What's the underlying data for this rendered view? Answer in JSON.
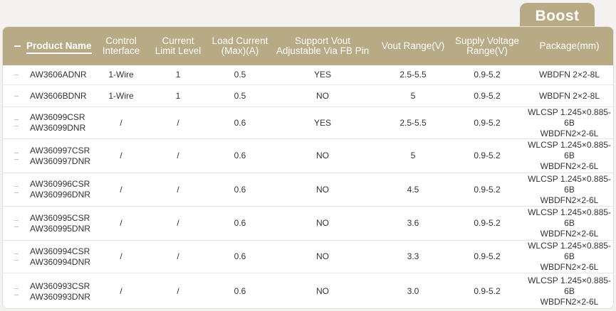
{
  "tab": {
    "label": "Boost"
  },
  "columns": [
    "Product Name",
    "Control\nInterface",
    "Current\nLimit Level",
    "Load Current\n(Max)(A)",
    "Support Vout\nAdjustable Via FB Pin",
    "Vout Range(V)",
    "Supply Voltage\nRange(V)",
    "Package(mm)"
  ],
  "rows": [
    {
      "name": "AW3606ADNR",
      "control": "1-Wire",
      "limit": "1",
      "load": "0.5",
      "fb": "YES",
      "vout": "2.5-5.5",
      "supply": "0.9-5.2",
      "pkg": "WBDFN 2×2-8L"
    },
    {
      "name": "AW3606BDNR",
      "control": "1-Wire",
      "limit": "1",
      "load": "0.5",
      "fb": "NO",
      "vout": "5",
      "supply": "0.9-5.2",
      "pkg": "WBDFN 2×2-8L"
    },
    {
      "name": "AW36099CSR\nAW36099DNR",
      "control": "/",
      "limit": "/",
      "load": "0.6",
      "fb": "YES",
      "vout": "2.5-5.5",
      "supply": "0.9-5.2",
      "pkg": "WLCSP 1.245×0.885-6B\nWBDFN2×2-6L"
    },
    {
      "name": "AW360997CSR\nAW360997DNR",
      "control": "/",
      "limit": "/",
      "load": "0.6",
      "fb": "NO",
      "vout": "5",
      "supply": "0.9-5.2",
      "pkg": "WLCSP 1.245×0.885-6B\nWBDFN2×2-6L"
    },
    {
      "name": "AW360996CSR\nAW360996DNR",
      "control": "/",
      "limit": "/",
      "load": "0.6",
      "fb": "NO",
      "vout": "4.5",
      "supply": "0.9-5.2",
      "pkg": "WLCSP 1.245×0.885-6B\nWBDFN2×2-6L"
    },
    {
      "name": "AW360995CSR\nAW360995DNR",
      "control": "/",
      "limit": "/",
      "load": "0.6",
      "fb": "NO",
      "vout": "3.6",
      "supply": "0.9-5.2",
      "pkg": "WLCSP 1.245×0.885-6B\nWBDFN2×2-6L"
    },
    {
      "name": "AW360994CSR\nAW360994DNR",
      "control": "/",
      "limit": "/",
      "load": "0.6",
      "fb": "NO",
      "vout": "3.3",
      "supply": "0.9-5.2",
      "pkg": "WLCSP 1.245×0.885-6B\nWBDFN2×2-6L"
    },
    {
      "name": "AW360993CSR\nAW360993DNR",
      "control": "/",
      "limit": "/",
      "load": "0.6",
      "fb": "NO",
      "vout": "3.0",
      "supply": "0.9-5.2",
      "pkg": "WLCSP 1.245×0.885-6B\nWBDFN2×2-6L"
    }
  ],
  "colors": {
    "accent": "#b8aa84",
    "text": "#333333"
  }
}
